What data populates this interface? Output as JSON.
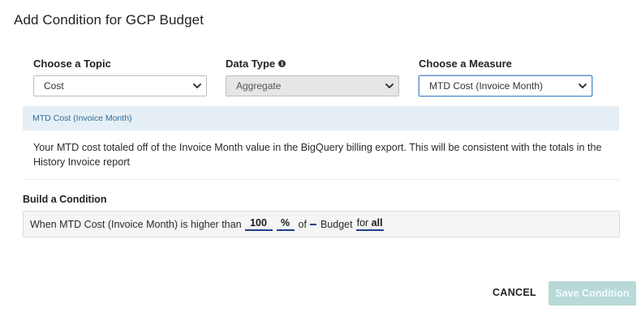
{
  "dialog": {
    "title": "Add Condition for GCP Budget"
  },
  "topic": {
    "label": "Choose a Topic",
    "value": "Cost"
  },
  "data_type": {
    "label": "Data Type",
    "value": "Aggregate",
    "info_icon": "info-circle"
  },
  "measure": {
    "label": "Choose a Measure",
    "value": "MTD Cost (Invoice Month)"
  },
  "measure_panel": {
    "title": "MTD Cost (Invoice Month)",
    "description": "Your MTD cost totaled off of the Invoice Month value in the BigQuery billing export. This will be consistent with the totals in the History Invoice report"
  },
  "condition": {
    "label": "Build a Condition",
    "prefix": "When MTD Cost (Invoice Month) is higher than",
    "amount": "100",
    "unit": "%",
    "of_text": "of",
    "target_blank": "",
    "target_text": "Budget",
    "scope_prefix": "for",
    "scope_value": "all"
  },
  "actions": {
    "cancel": "CANCEL",
    "save": "Save Condition"
  },
  "colors": {
    "accent": "#5b8ec9",
    "panel_header": "#e5eff5",
    "save_disabled": "#b7d9d7",
    "underline": "#1f3f8a"
  }
}
